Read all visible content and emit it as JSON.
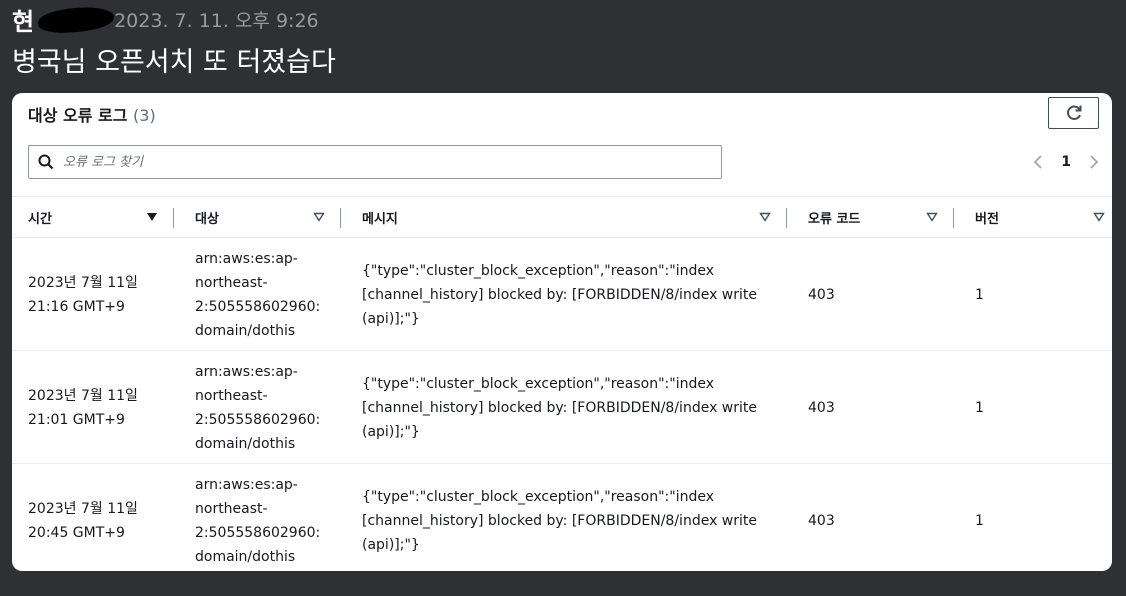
{
  "chat": {
    "sender_visible": "현",
    "timestamp": "2023. 7. 11. 오후 9:26",
    "message": "병국님 오픈서치 또 터졌습다"
  },
  "panel": {
    "title": "대상 오류 로그",
    "count": "(3)",
    "refresh_icon": "refresh-icon",
    "search": {
      "placeholder": "오류 로그 찾기",
      "value": "",
      "icon": "search-icon"
    },
    "pagination": {
      "page": "1",
      "prev_icon": "chevron-left-icon",
      "next_icon": "chevron-right-icon"
    },
    "columns": [
      "시간",
      "대상",
      "메시지",
      "오류 코드",
      "버전"
    ],
    "rows": [
      {
        "time_date": "2023년 7월 11일",
        "time_clock": "21:16 GMT+9",
        "target": [
          "arn:aws:es:ap-",
          "northeast-",
          "2:505558602960:",
          "domain/dothis"
        ],
        "message": [
          "{\"type\":\"cluster_block_exception\",\"reason\":\"index",
          "[channel_history] blocked by: [FORBIDDEN/8/index write",
          "(api)];\"}"
        ],
        "code": "403",
        "version": "1"
      },
      {
        "time_date": "2023년 7월 11일",
        "time_clock": "21:01 GMT+9",
        "target": [
          "arn:aws:es:ap-",
          "northeast-",
          "2:505558602960:",
          "domain/dothis"
        ],
        "message": [
          "{\"type\":\"cluster_block_exception\",\"reason\":\"index",
          "[channel_history] blocked by: [FORBIDDEN/8/index write",
          "(api)];\"}"
        ],
        "code": "403",
        "version": "1"
      },
      {
        "time_date": "2023년 7월 11일",
        "time_clock": "20:45 GMT+9",
        "target": [
          "arn:aws:es:ap-",
          "northeast-",
          "2:505558602960:",
          "domain/dothis"
        ],
        "message": [
          "{\"type\":\"cluster_block_exception\",\"reason\":\"index",
          "[channel_history] blocked by: [FORBIDDEN/8/index write",
          "(api)];\"}"
        ],
        "code": "403",
        "version": "1"
      }
    ]
  }
}
